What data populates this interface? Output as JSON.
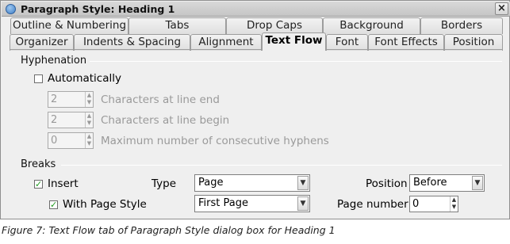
{
  "window": {
    "title": "Paragraph Style: Heading 1",
    "close_glyph": "×"
  },
  "tabs_row1": [
    "Outline & Numbering",
    "Tabs",
    "Drop Caps",
    "Background",
    "Borders"
  ],
  "tabs_row2": [
    "Organizer",
    "Indents & Spacing",
    "Alignment",
    "Text Flow",
    "Font",
    "Font Effects",
    "Position"
  ],
  "active_tab": "Text Flow",
  "hyphenation": {
    "title": "Hyphenation",
    "auto_label": "Automatically",
    "auto_checked": false,
    "line_end_value": "2",
    "line_end_label": "Characters at line end",
    "line_begin_value": "2",
    "line_begin_label": "Characters at line begin",
    "max_value": "0",
    "max_label": "Maximum number of consecutive hyphens"
  },
  "breaks": {
    "title": "Breaks",
    "insert_label": "Insert",
    "insert_checked": true,
    "type_label": "Type",
    "type_value": "Page",
    "position_label": "Position",
    "position_value": "Before",
    "page_style_label": "With Page Style",
    "page_style_checked": true,
    "page_style_value": "First Page",
    "page_number_label": "Page number",
    "page_number_value": "0"
  },
  "caption": "Figure 7: Text Flow tab of Paragraph Style dialog box for Heading 1",
  "colors": {
    "check": "#1f9a1f",
    "disabled_text": "#9a9a9a",
    "dialog_bg": "#efefef"
  },
  "icons": {
    "title": "app-icon",
    "check": "checkmark-icon",
    "dropdown": "chevron-down-icon"
  }
}
